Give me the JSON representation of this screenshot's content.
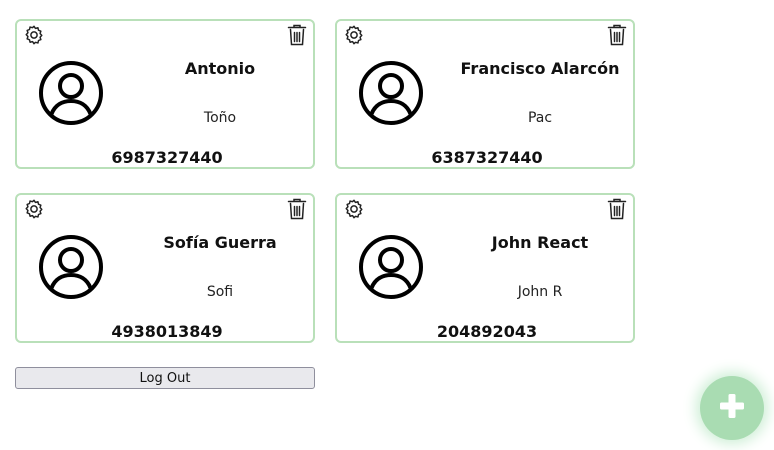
{
  "contacts": [
    {
      "name": "Antonio",
      "nickname": "Toño",
      "phone": "6987327440"
    },
    {
      "name": "Francisco Alarcón",
      "nickname": "Pac",
      "phone": "6387327440"
    },
    {
      "name": "Sofía Guerra",
      "nickname": "Sofi",
      "phone": "4938013849"
    },
    {
      "name": "John React",
      "nickname": "John R",
      "phone": "204892043"
    }
  ],
  "logout_label": "Log Out",
  "icons": {
    "settings": "gear-icon",
    "delete": "trash-icon",
    "avatar": "user-avatar-icon",
    "add": "plus-icon"
  },
  "colors": {
    "card_border": "#b9e0b9",
    "fab_background": "#a9dcb2"
  }
}
